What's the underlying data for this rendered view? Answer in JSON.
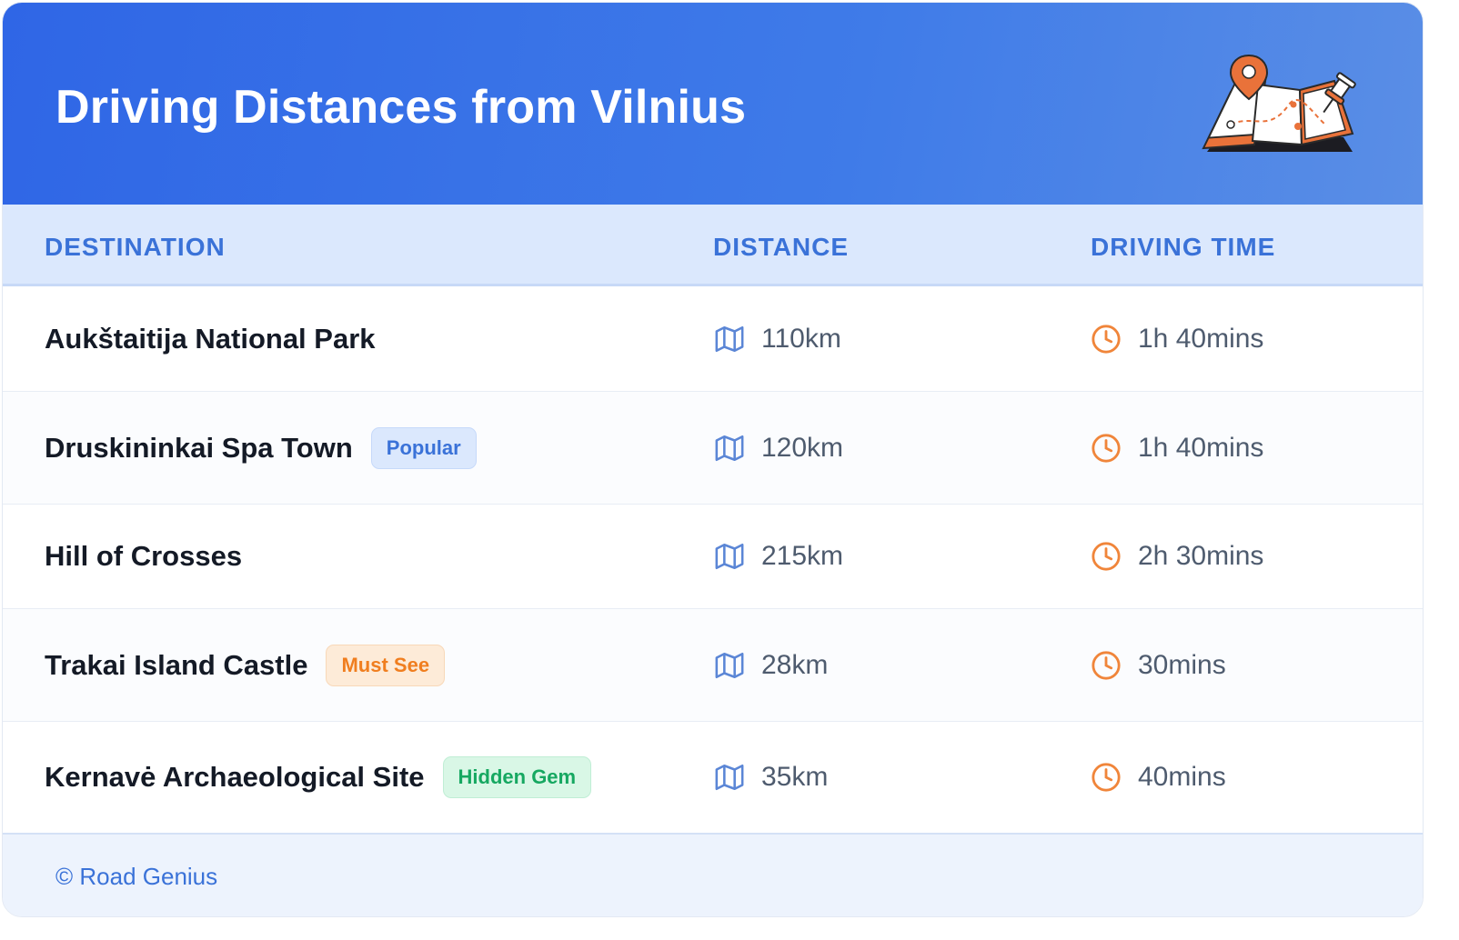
{
  "header": {
    "title": "Driving Distances from Vilnius",
    "illustration_icon": "folded-map-with-pins-icon"
  },
  "table": {
    "columns": [
      "DESTINATION",
      "DISTANCE",
      "DRIVING TIME"
    ],
    "distance_icon": "map-icon",
    "time_icon": "clock-icon",
    "rows": [
      {
        "destination": "Aukštaitija National Park",
        "badge": "",
        "distance": "110km",
        "time": "1h 40mins"
      },
      {
        "destination": "Druskininkai Spa Town",
        "badge": "Popular",
        "distance": "120km",
        "time": "1h 40mins"
      },
      {
        "destination": "Hill of Crosses",
        "badge": "",
        "distance": "215km",
        "time": "2h 30mins"
      },
      {
        "destination": "Trakai Island Castle",
        "badge": "Must See",
        "distance": "28km",
        "time": "30mins"
      },
      {
        "destination": "Kernavė Archaeological Site",
        "badge": "Hidden Gem",
        "distance": "35km",
        "time": "40mins"
      }
    ]
  },
  "footer": {
    "text": "© Road Genius"
  },
  "colors": {
    "header_blue": "#2f66e6",
    "accent_blue": "#3a72d8",
    "orange": "#f07e1f",
    "green": "#16a861"
  }
}
